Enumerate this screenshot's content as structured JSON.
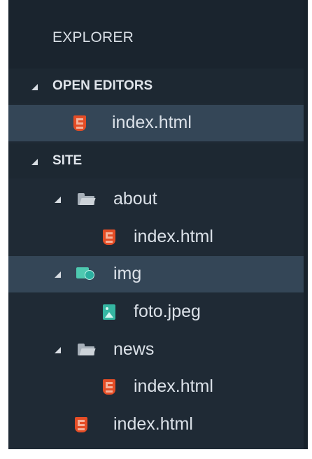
{
  "explorer": {
    "title": "EXPLORER"
  },
  "open_editors": {
    "label": "OPEN EDITORS",
    "items": [
      {
        "label": "index.html",
        "icon": "html5-icon",
        "selected": true
      }
    ]
  },
  "site": {
    "label": "SITE",
    "about": {
      "label": "about",
      "icon": "folder-open-icon",
      "file": {
        "label": "index.html",
        "icon": "html5-icon"
      }
    },
    "img": {
      "label": "img",
      "icon": "image-folder-icon",
      "selected": true,
      "file": {
        "label": "foto.jpeg",
        "icon": "image-file-icon"
      }
    },
    "news": {
      "label": "news",
      "icon": "folder-open-icon",
      "file": {
        "label": "index.html",
        "icon": "html5-icon"
      }
    },
    "root_file": {
      "label": "index.html",
      "icon": "html5-icon"
    }
  },
  "colors": {
    "panel_background": "#1f2a35",
    "selected_row": "#344657",
    "html_icon": "#e44d26",
    "image_icon": "#35b6a2",
    "folder_icon": "#a7b0b9"
  }
}
